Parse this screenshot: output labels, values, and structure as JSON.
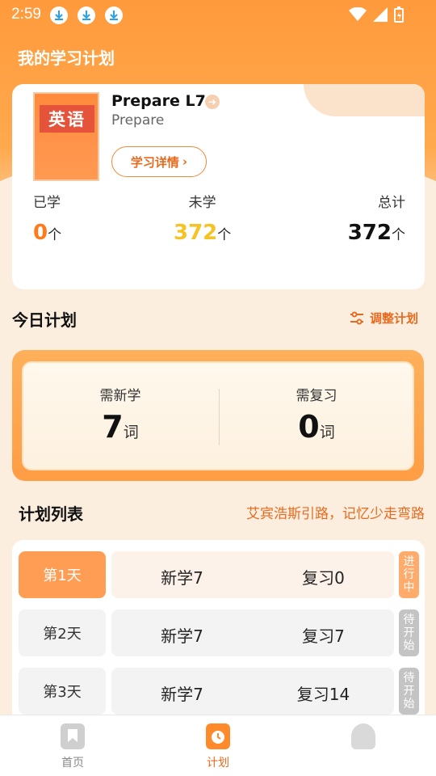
{
  "status_bar": {
    "time": "2:59",
    "download_icons": [
      "download-icon",
      "download-icon",
      "download-icon"
    ],
    "right_icons": [
      "wifi-icon",
      "signal-icon",
      "battery-icon"
    ]
  },
  "header": {
    "title": "我的学习计划"
  },
  "book": {
    "cover_label": "英语",
    "title": "Prepare L7",
    "subtitle": "Prepare",
    "detail_button": "学习详情",
    "stats": {
      "learned": {
        "label": "已学",
        "value": "0",
        "unit": "个",
        "color": "#ff7a1a"
      },
      "unlearned": {
        "label": "未学",
        "value": "372",
        "unit": "个",
        "color": "#f5c325"
      },
      "total": {
        "label": "总计",
        "value": "372",
        "unit": "个",
        "color": "#111111"
      }
    }
  },
  "today": {
    "title": "今日计划",
    "adjust_label": "调整计划",
    "new": {
      "label": "需新学",
      "value": "7",
      "unit": "词"
    },
    "review": {
      "label": "需复习",
      "value": "0",
      "unit": "词"
    }
  },
  "plan_list": {
    "title": "计划列表",
    "slogan": "艾宾浩斯引路，记忆少走弯路",
    "rows": [
      {
        "day": "第1天",
        "new": "新学7",
        "review": "复习0",
        "status": "进行中"
      },
      {
        "day": "第2天",
        "new": "新学7",
        "review": "复习7",
        "status": "待开始"
      },
      {
        "day": "第3天",
        "new": "新学7",
        "review": "复习14",
        "status": "待开始"
      }
    ]
  },
  "nav": {
    "items": [
      {
        "label": "首页",
        "icon": "bookmark-icon"
      },
      {
        "label": "计划",
        "icon": "clock-icon"
      },
      {
        "label": "",
        "icon": "profile-icon"
      }
    ]
  },
  "colors": {
    "accent": "#ff9d44",
    "accent_text": "#e86a1e"
  }
}
